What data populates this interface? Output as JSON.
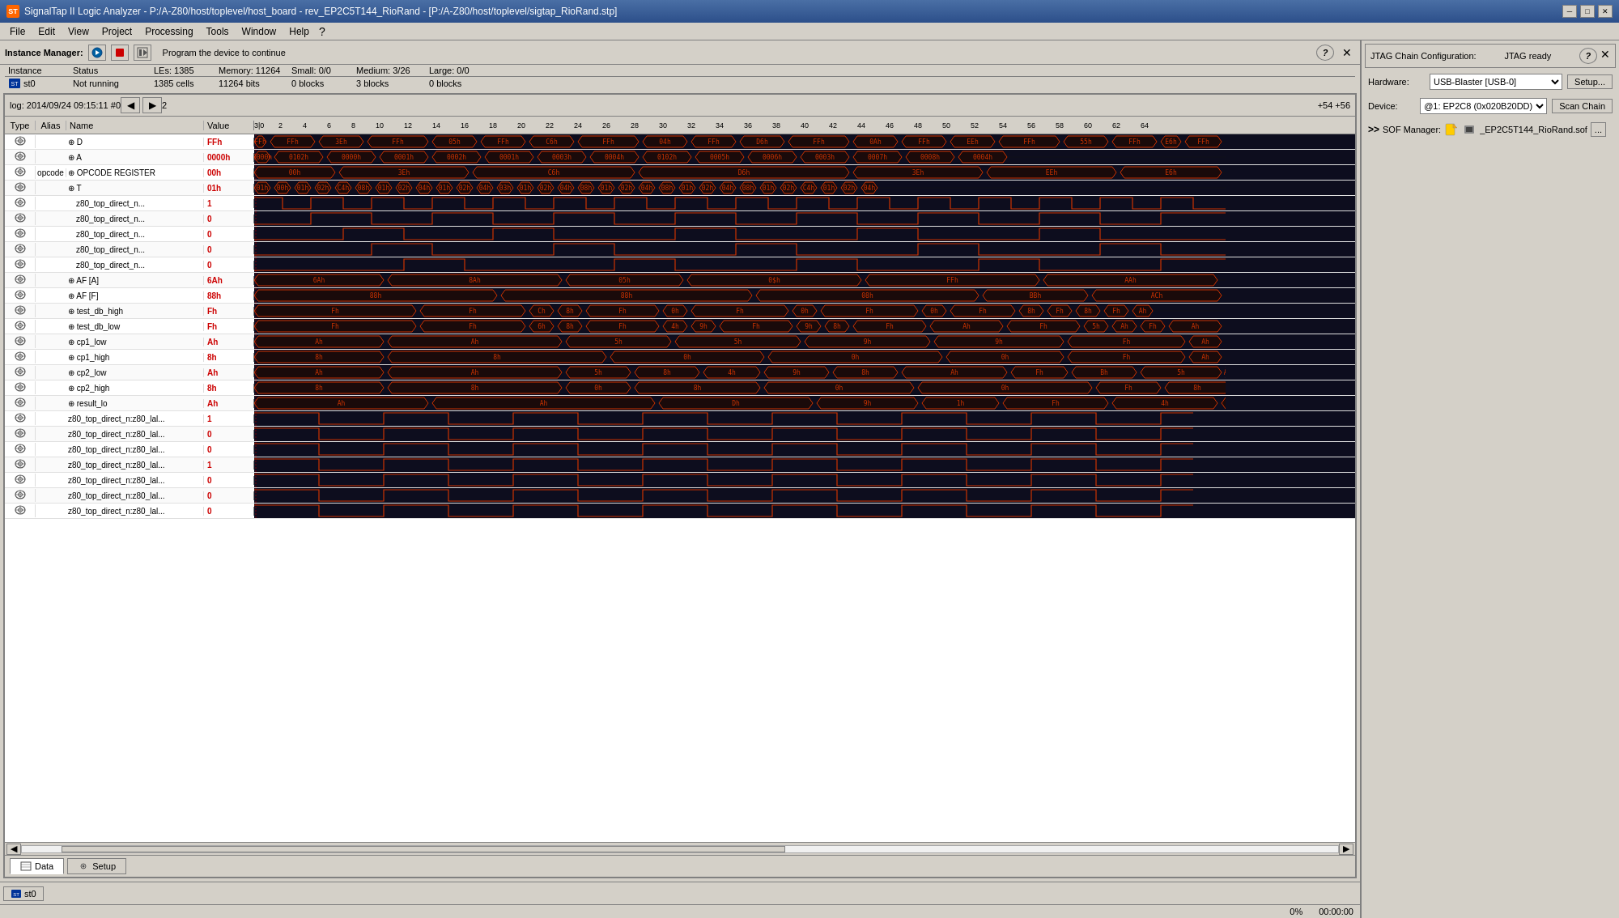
{
  "titleBar": {
    "icon": "ST",
    "title": "SignalTap II Logic Analyzer - P:/A-Z80/host/toplevel/host_board - rev_EP2C5T144_RioRand - [P:/A-Z80/host/toplevel/sigtap_RioRand.stp]",
    "controls": [
      "minimize",
      "maximize",
      "close"
    ]
  },
  "menuBar": {
    "items": [
      "File",
      "Edit",
      "View",
      "Project",
      "Processing",
      "Tools",
      "Window",
      "Help"
    ]
  },
  "instanceManager": {
    "label": "Instance Manager:",
    "programMsg": "Program the device to continue",
    "columns": [
      "Instance",
      "Status",
      "LEs:",
      "Memory:",
      "Small:",
      "Medium:",
      "Large:"
    ],
    "rows": [
      {
        "instance": "st0",
        "status": "Not running",
        "les": "1385 cells",
        "lesHeader": "1385",
        "memory": "11264 bits",
        "memoryHeader": "11264",
        "small": "0 blocks",
        "smallHeader": "0/0",
        "medium": "3 blocks",
        "mediumHeader": "3/26",
        "large": "0 blocks",
        "largeHeader": "0/0"
      }
    ]
  },
  "analyzer": {
    "logInfo": "log: 2014/09/24 09:15:11  #0",
    "cursor1Label": "2",
    "cursor2Label": "+54   +56",
    "timeMarkers": [
      "2",
      "0",
      "2",
      "4",
      "6",
      "8",
      "10",
      "12",
      "14",
      "16",
      "18",
      "20",
      "22",
      "24",
      "26",
      "28",
      "30",
      "32",
      "34",
      "36",
      "38",
      "40",
      "42",
      "44",
      "46",
      "48",
      "50",
      "52",
      "54",
      "56",
      "58",
      "60",
      "62",
      "64"
    ],
    "columns": {
      "type": "Type",
      "alias": "Alias",
      "name": "Name",
      "value": "Value"
    },
    "signals": [
      {
        "type": "eye",
        "alias": "",
        "name": "⊕ D",
        "value": "FFh",
        "indent": 0,
        "waveType": "bus",
        "color": "#cc0000"
      },
      {
        "type": "eye",
        "alias": "",
        "name": "⊕ A",
        "value": "0000h",
        "indent": 0,
        "waveType": "bus",
        "color": "#cc0000"
      },
      {
        "type": "eye",
        "alias": "opcode",
        "name": "⊕ OPCODE REGISTER",
        "value": "00h",
        "indent": 0,
        "waveType": "bus",
        "color": "#cc0000"
      },
      {
        "type": "eye",
        "alias": "",
        "name": "⊕ T",
        "value": "01h",
        "indent": 0,
        "waveType": "bus",
        "color": "#cc0000"
      },
      {
        "type": "eye",
        "alias": "",
        "name": "  z80_top_direct_n...",
        "value": "1",
        "indent": 1,
        "waveType": "digital",
        "color": "#cc0000"
      },
      {
        "type": "eye",
        "alias": "",
        "name": "  z80_top_direct_n...",
        "value": "0",
        "indent": 1,
        "waveType": "digital",
        "color": "#cc0000"
      },
      {
        "type": "eye",
        "alias": "",
        "name": "  z80_top_direct_n...",
        "value": "0",
        "indent": 1,
        "waveType": "digital",
        "color": "#cc0000"
      },
      {
        "type": "eye",
        "alias": "",
        "name": "  z80_top_direct_n...",
        "value": "0",
        "indent": 1,
        "waveType": "digital",
        "color": "#cc0000"
      },
      {
        "type": "eye",
        "alias": "",
        "name": "  z80_top_direct_n...",
        "value": "0",
        "indent": 1,
        "waveType": "digital",
        "color": "#cc0000"
      },
      {
        "type": "eye",
        "alias": "",
        "name": "⊕ AF [A]",
        "value": "6Ah",
        "indent": 0,
        "waveType": "bus",
        "color": "#cc0000"
      },
      {
        "type": "eye",
        "alias": "",
        "name": "⊕ AF [F]",
        "value": "88h",
        "indent": 0,
        "waveType": "bus",
        "color": "#cc0000"
      },
      {
        "type": "eye",
        "alias": "",
        "name": "⊕ test_db_high",
        "value": "Fh",
        "indent": 0,
        "waveType": "bus",
        "color": "#cc0000"
      },
      {
        "type": "eye",
        "alias": "",
        "name": "⊕ test_db_low",
        "value": "Fh",
        "indent": 0,
        "waveType": "bus",
        "color": "#cc0000"
      },
      {
        "type": "eye",
        "alias": "",
        "name": "⊕ cp1_low",
        "value": "Ah",
        "indent": 0,
        "waveType": "bus",
        "color": "#cc0000"
      },
      {
        "type": "eye",
        "alias": "",
        "name": "⊕ cp1_high",
        "value": "8h",
        "indent": 0,
        "waveType": "bus",
        "color": "#cc0000"
      },
      {
        "type": "eye",
        "alias": "",
        "name": "⊕ cp2_low",
        "value": "Ah",
        "indent": 0,
        "waveType": "bus",
        "color": "#cc0000"
      },
      {
        "type": "eye",
        "alias": "",
        "name": "⊕ cp2_high",
        "value": "8h",
        "indent": 0,
        "waveType": "bus",
        "color": "#cc0000"
      },
      {
        "type": "eye",
        "alias": "",
        "name": "⊕ result_lo",
        "value": "Ah",
        "indent": 0,
        "waveType": "bus",
        "color": "#cc0000"
      },
      {
        "type": "eye",
        "alias": "",
        "name": "z80_top_direct_n:z80_lal...",
        "value": "1",
        "indent": 0,
        "waveType": "digital",
        "color": "#cc0000"
      },
      {
        "type": "eye",
        "alias": "",
        "name": "z80_top_direct_n:z80_lal...",
        "value": "0",
        "indent": 0,
        "waveType": "digital",
        "color": "#cc0000"
      },
      {
        "type": "eye",
        "alias": "",
        "name": "z80_top_direct_n:z80_lal...",
        "value": "0",
        "indent": 0,
        "waveType": "digital",
        "color": "#cc0000"
      },
      {
        "type": "eye",
        "alias": "",
        "name": "z80_top_direct_n:z80_lal...",
        "value": "1",
        "indent": 0,
        "waveType": "digital",
        "color": "#cc0000"
      },
      {
        "type": "eye",
        "alias": "",
        "name": "z80_top_direct_n:z80_lal...",
        "value": "0",
        "indent": 0,
        "waveType": "digital",
        "color": "#cc0000"
      },
      {
        "type": "eye",
        "alias": "",
        "name": "z80_top_direct_n:z80_lal...",
        "value": "0",
        "indent": 0,
        "waveType": "digital",
        "color": "#cc0000"
      },
      {
        "type": "eye",
        "alias": "",
        "name": "z80_top_direct_n:z80_lal...",
        "value": "0",
        "indent": 0,
        "waveType": "digital",
        "color": "#cc0000"
      }
    ]
  },
  "jtag": {
    "configLabel": "JTAG Chain Configuration:",
    "status": "JTAG ready",
    "hardwareLabel": "Hardware:",
    "hardwareValue": "USB-Blaster [USB-0]",
    "deviceLabel": "Device:",
    "deviceValue": "@1: EP2C8 (0x020B20DD)",
    "setupBtn": "Setup...",
    "scanChainBtn": "Scan Chain",
    "sofLabel": "SOF Manager:",
    "sofFile": "_EP2C5T144_RioRand.sof",
    "dotsBtn": "..."
  },
  "bottomTabs": [
    {
      "label": "Data",
      "icon": "📊",
      "active": true
    },
    {
      "label": "Setup",
      "icon": "⚙",
      "active": false
    }
  ],
  "instanceTabs": [
    {
      "label": "st0",
      "icon": "📊"
    }
  ],
  "statusBar": {
    "progress": "0%",
    "time": "00:00:00"
  }
}
